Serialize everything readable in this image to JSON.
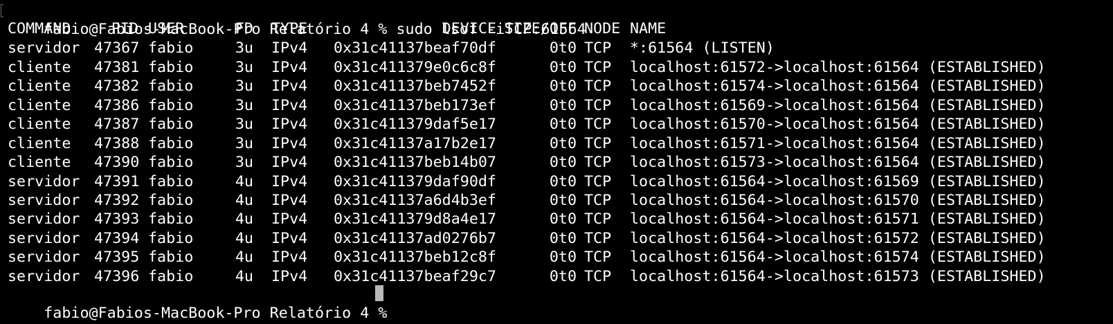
{
  "terminal": {
    "user": "fabio",
    "host": "Fabios-MacBook-Pro",
    "cwd": "Relatório 4",
    "prompt_symbol": "%",
    "command_prompt": "fabio@Fabios-MacBook-Pro Relatório 4 % sudo lsof -iTCP:61564",
    "final_prompt": "fabio@Fabios-MacBook-Pro Relatório 4 % "
  },
  "lsof": {
    "headers": [
      "COMMAND",
      "PID",
      "USER",
      "FD",
      "TYPE",
      "DEVICE",
      "SIZE/OFF",
      "NODE",
      "NAME"
    ],
    "rows": [
      {
        "command": "servidor",
        "pid": "47367",
        "user": "fabio",
        "fd": "3u",
        "type": "IPv4",
        "device": "0x31c41137beaf70df",
        "size_off": "0t0",
        "node": "TCP",
        "name": "*:61564 (LISTEN)"
      },
      {
        "command": "cliente",
        "pid": "47381",
        "user": "fabio",
        "fd": "3u",
        "type": "IPv4",
        "device": "0x31c411379e0c6c8f",
        "size_off": "0t0",
        "node": "TCP",
        "name": "localhost:61572->localhost:61564 (ESTABLISHED)"
      },
      {
        "command": "cliente",
        "pid": "47382",
        "user": "fabio",
        "fd": "3u",
        "type": "IPv4",
        "device": "0x31c41137beb7452f",
        "size_off": "0t0",
        "node": "TCP",
        "name": "localhost:61574->localhost:61564 (ESTABLISHED)"
      },
      {
        "command": "cliente",
        "pid": "47386",
        "user": "fabio",
        "fd": "3u",
        "type": "IPv4",
        "device": "0x31c41137beb173ef",
        "size_off": "0t0",
        "node": "TCP",
        "name": "localhost:61569->localhost:61564 (ESTABLISHED)"
      },
      {
        "command": "cliente",
        "pid": "47387",
        "user": "fabio",
        "fd": "3u",
        "type": "IPv4",
        "device": "0x31c411379daf5e17",
        "size_off": "0t0",
        "node": "TCP",
        "name": "localhost:61570->localhost:61564 (ESTABLISHED)"
      },
      {
        "command": "cliente",
        "pid": "47388",
        "user": "fabio",
        "fd": "3u",
        "type": "IPv4",
        "device": "0x31c41137a17b2e17",
        "size_off": "0t0",
        "node": "TCP",
        "name": "localhost:61571->localhost:61564 (ESTABLISHED)"
      },
      {
        "command": "cliente",
        "pid": "47390",
        "user": "fabio",
        "fd": "3u",
        "type": "IPv4",
        "device": "0x31c41137beb14b07",
        "size_off": "0t0",
        "node": "TCP",
        "name": "localhost:61573->localhost:61564 (ESTABLISHED)"
      },
      {
        "command": "servidor",
        "pid": "47391",
        "user": "fabio",
        "fd": "4u",
        "type": "IPv4",
        "device": "0x31c411379daf90df",
        "size_off": "0t0",
        "node": "TCP",
        "name": "localhost:61564->localhost:61569 (ESTABLISHED)"
      },
      {
        "command": "servidor",
        "pid": "47392",
        "user": "fabio",
        "fd": "4u",
        "type": "IPv4",
        "device": "0x31c41137a6d4b3ef",
        "size_off": "0t0",
        "node": "TCP",
        "name": "localhost:61564->localhost:61570 (ESTABLISHED)"
      },
      {
        "command": "servidor",
        "pid": "47393",
        "user": "fabio",
        "fd": "4u",
        "type": "IPv4",
        "device": "0x31c411379d8a4e17",
        "size_off": "0t0",
        "node": "TCP",
        "name": "localhost:61564->localhost:61571 (ESTABLISHED)"
      },
      {
        "command": "servidor",
        "pid": "47394",
        "user": "fabio",
        "fd": "4u",
        "type": "IPv4",
        "device": "0x31c41137ad0276b7",
        "size_off": "0t0",
        "node": "TCP",
        "name": "localhost:61564->localhost:61572 (ESTABLISHED)"
      },
      {
        "command": "servidor",
        "pid": "47395",
        "user": "fabio",
        "fd": "4u",
        "type": "IPv4",
        "device": "0x31c41137beb12c8f",
        "size_off": "0t0",
        "node": "TCP",
        "name": "localhost:61564->localhost:61574 (ESTABLISHED)"
      },
      {
        "command": "servidor",
        "pid": "47396",
        "user": "fabio",
        "fd": "4u",
        "type": "IPv4",
        "device": "0x31c41137beaf29c7",
        "size_off": "0t0",
        "node": "TCP",
        "name": "localhost:61564->localhost:61573 (ESTABLISHED)"
      }
    ]
  },
  "colors": {
    "background": "#000000",
    "text": "#ffffff",
    "cursor": "#b9b9b9"
  }
}
